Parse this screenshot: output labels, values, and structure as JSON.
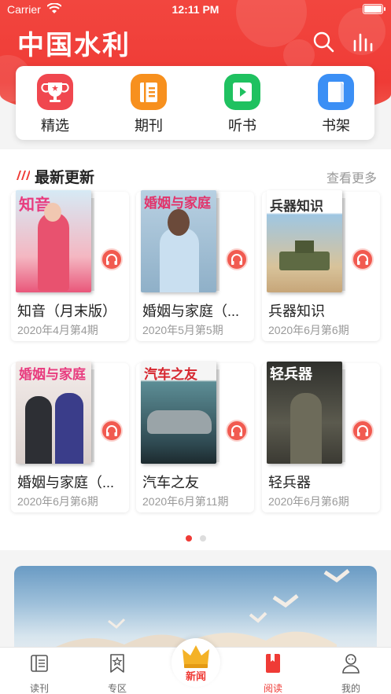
{
  "status_bar": {
    "carrier": "Carrier",
    "time": "12:11 PM"
  },
  "header": {
    "app_title": "中国水利"
  },
  "quick_nav": [
    {
      "label": "精选",
      "icon": "trophy-icon",
      "color": "#f0474f"
    },
    {
      "label": "期刊",
      "icon": "magazine-icon",
      "color": "#f7901e"
    },
    {
      "label": "听书",
      "icon": "play-icon",
      "color": "#1fc160"
    },
    {
      "label": "书架",
      "icon": "book-icon",
      "color": "#3b8ff5"
    }
  ],
  "latest": {
    "title": "最新更新",
    "more_label": "查看更多",
    "items": [
      {
        "name": "知音（月末版）",
        "issue": "2020年4月第4期",
        "cover_text": "知音",
        "cover_bg": "#cfe3ef"
      },
      {
        "name": "婚姻与家庭（...",
        "issue": "2020年5月第5期",
        "cover_text": "婚姻与家庭",
        "cover_bg": "#9bb8cf"
      },
      {
        "name": "兵器知识",
        "issue": "2020年6月第6期",
        "cover_text": "兵器知识",
        "cover_bg": "#9fbfd8"
      },
      {
        "name": "婚姻与家庭（...",
        "issue": "2020年6月第6期",
        "cover_text": "婚姻与家庭",
        "cover_bg": "#e8e0dc"
      },
      {
        "name": "汽车之友",
        "issue": "2020年6月第11期",
        "cover_text": "汽车之友",
        "cover_bg": "#4f7a80"
      },
      {
        "name": "轻兵器",
        "issue": "2020年6月第6期",
        "cover_text": "轻兵器",
        "cover_bg": "#4a4a45"
      }
    ],
    "page_count": 2,
    "active_page": 1
  },
  "tabs": [
    {
      "label": "读刊",
      "icon": "reader-icon"
    },
    {
      "label": "专区",
      "icon": "star-bookmark-icon"
    },
    {
      "label": "新闻",
      "icon": "crown-icon"
    },
    {
      "label": "阅读",
      "icon": "red-book-icon"
    },
    {
      "label": "我的",
      "icon": "profile-icon"
    }
  ],
  "colors": {
    "brand_red": "#ef3b36",
    "accent_pink": "#e83b7e"
  }
}
